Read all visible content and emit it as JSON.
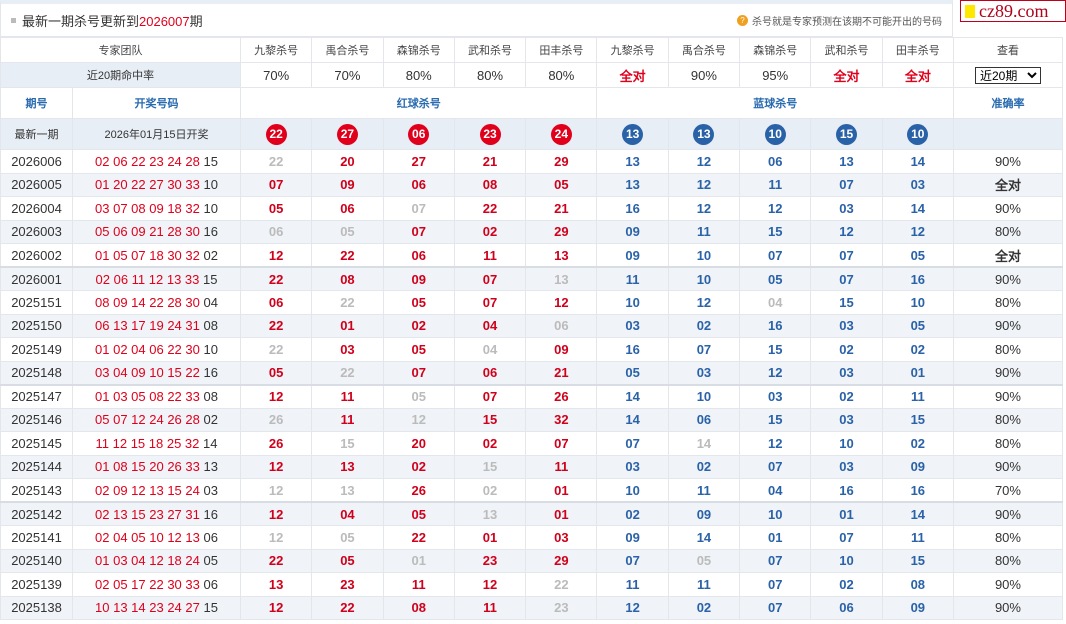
{
  "header": {
    "title_prefix": "最新一期杀号更新到",
    "latest_period": "2026007",
    "title_suffix": "期",
    "note": "杀号就是专家预测在该期不可能开出的号码",
    "note_icon": "question-icon"
  },
  "logo": "cz89.com",
  "experts": {
    "label": "专家团队",
    "names": [
      "九黎杀号",
      "禹合杀号",
      "森锦杀号",
      "武和杀号",
      "田丰杀号",
      "九黎杀号",
      "禹合杀号",
      "森锦杀号",
      "武和杀号",
      "田丰杀号"
    ],
    "view_label": "查看"
  },
  "rates": {
    "label": "近20期命中率",
    "values": [
      "70%",
      "70%",
      "80%",
      "80%",
      "80%",
      "全对",
      "90%",
      "95%",
      "全对",
      "全对"
    ],
    "select_value": "近20期"
  },
  "columns": {
    "period": "期号",
    "draw": "开奖号码",
    "red": "红球杀号",
    "blue": "蓝球杀号",
    "accuracy": "准确率"
  },
  "latest": {
    "label": "最新一期",
    "date": "2026年01月15日开奖",
    "red": [
      "22",
      "27",
      "06",
      "23",
      "24"
    ],
    "blue": [
      "13",
      "13",
      "10",
      "15",
      "10"
    ]
  },
  "colors": {
    "red": "#e0001b",
    "blue": "#2a62a8",
    "miss": "#bbbbbb"
  },
  "rows": [
    {
      "period": "2026006",
      "red_draw": "02 06 22 23 24 28",
      "blue_draw": "15",
      "red": [
        "22",
        "20",
        "27",
        "21",
        "29"
      ],
      "blue": [
        "13",
        "12",
        "06",
        "13",
        "14"
      ],
      "miss": [
        0
      ],
      "acc": "90%"
    },
    {
      "period": "2026005",
      "red_draw": "01 20 22 27 30 33",
      "blue_draw": "10",
      "red": [
        "07",
        "09",
        "06",
        "08",
        "05"
      ],
      "blue": [
        "13",
        "12",
        "11",
        "07",
        "03"
      ],
      "miss": [],
      "acc": "全对"
    },
    {
      "period": "2026004",
      "red_draw": "03 07 08 09 18 32",
      "blue_draw": "10",
      "red": [
        "05",
        "06",
        "07",
        "22",
        "21"
      ],
      "blue": [
        "16",
        "12",
        "12",
        "03",
        "14"
      ],
      "miss": [
        2
      ],
      "acc": "90%"
    },
    {
      "period": "2026003",
      "red_draw": "05 06 09 21 28 30",
      "blue_draw": "16",
      "red": [
        "06",
        "05",
        "07",
        "02",
        "29"
      ],
      "blue": [
        "09",
        "11",
        "15",
        "12",
        "12"
      ],
      "miss": [
        0,
        1
      ],
      "acc": "80%"
    },
    {
      "period": "2026002",
      "red_draw": "01 05 07 18 30 32",
      "blue_draw": "02",
      "red": [
        "12",
        "22",
        "06",
        "11",
        "13"
      ],
      "blue": [
        "09",
        "10",
        "07",
        "07",
        "05"
      ],
      "miss": [],
      "acc": "全对"
    },
    {
      "period": "2026001",
      "red_draw": "02 06 11 12 13 33",
      "blue_draw": "15",
      "red": [
        "22",
        "08",
        "09",
        "07",
        "13"
      ],
      "blue": [
        "11",
        "10",
        "05",
        "07",
        "16"
      ],
      "miss": [
        4
      ],
      "acc": "90%"
    },
    {
      "period": "2025151",
      "red_draw": "08 09 14 22 28 30",
      "blue_draw": "04",
      "red": [
        "06",
        "22",
        "05",
        "07",
        "12"
      ],
      "blue": [
        "10",
        "12",
        "04",
        "15",
        "10"
      ],
      "miss": [
        1,
        7
      ],
      "acc": "80%"
    },
    {
      "period": "2025150",
      "red_draw": "06 13 17 19 24 31",
      "blue_draw": "08",
      "red": [
        "22",
        "01",
        "02",
        "04",
        "06"
      ],
      "blue": [
        "03",
        "02",
        "16",
        "03",
        "05"
      ],
      "miss": [
        4
      ],
      "acc": "90%"
    },
    {
      "period": "2025149",
      "red_draw": "01 02 04 06 22 30",
      "blue_draw": "10",
      "red": [
        "22",
        "03",
        "05",
        "04",
        "09"
      ],
      "blue": [
        "16",
        "07",
        "15",
        "02",
        "02"
      ],
      "miss": [
        0,
        3
      ],
      "acc": "80%"
    },
    {
      "period": "2025148",
      "red_draw": "03 04 09 10 15 22",
      "blue_draw": "16",
      "red": [
        "05",
        "22",
        "07",
        "06",
        "21"
      ],
      "blue": [
        "05",
        "03",
        "12",
        "03",
        "01"
      ],
      "miss": [
        1
      ],
      "acc": "90%"
    },
    {
      "period": "2025147",
      "red_draw": "01 03 05 08 22 33",
      "blue_draw": "08",
      "red": [
        "12",
        "11",
        "05",
        "07",
        "26"
      ],
      "blue": [
        "14",
        "10",
        "03",
        "02",
        "11"
      ],
      "miss": [
        2
      ],
      "acc": "90%"
    },
    {
      "period": "2025146",
      "red_draw": "05 07 12 24 26 28",
      "blue_draw": "02",
      "red": [
        "26",
        "11",
        "12",
        "15",
        "32"
      ],
      "blue": [
        "14",
        "06",
        "15",
        "03",
        "15"
      ],
      "miss": [
        0,
        2
      ],
      "acc": "80%"
    },
    {
      "period": "2025145",
      "red_draw": "11 12 15 18 25 32",
      "blue_draw": "14",
      "red": [
        "26",
        "15",
        "20",
        "02",
        "07"
      ],
      "blue": [
        "07",
        "14",
        "12",
        "10",
        "02"
      ],
      "miss": [
        1,
        6
      ],
      "acc": "80%"
    },
    {
      "period": "2025144",
      "red_draw": "01 08 15 20 26 33",
      "blue_draw": "13",
      "red": [
        "12",
        "13",
        "02",
        "15",
        "11"
      ],
      "blue": [
        "03",
        "02",
        "07",
        "03",
        "09"
      ],
      "miss": [
        3
      ],
      "acc": "90%"
    },
    {
      "period": "2025143",
      "red_draw": "02 09 12 13 15 24",
      "blue_draw": "03",
      "red": [
        "12",
        "13",
        "26",
        "02",
        "01"
      ],
      "blue": [
        "10",
        "11",
        "04",
        "16",
        "16"
      ],
      "miss": [
        0,
        1,
        3
      ],
      "acc": "70%"
    },
    {
      "period": "2025142",
      "red_draw": "02 13 15 23 27 31",
      "blue_draw": "16",
      "red": [
        "12",
        "04",
        "05",
        "13",
        "01"
      ],
      "blue": [
        "02",
        "09",
        "10",
        "01",
        "14"
      ],
      "miss": [
        3
      ],
      "acc": "90%"
    },
    {
      "period": "2025141",
      "red_draw": "02 04 05 10 12 13",
      "blue_draw": "06",
      "red": [
        "12",
        "05",
        "22",
        "01",
        "03"
      ],
      "blue": [
        "09",
        "14",
        "01",
        "07",
        "11"
      ],
      "miss": [
        0,
        1
      ],
      "acc": "80%"
    },
    {
      "period": "2025140",
      "red_draw": "01 03 04 12 18 24",
      "blue_draw": "05",
      "red": [
        "22",
        "05",
        "01",
        "23",
        "29"
      ],
      "blue": [
        "07",
        "05",
        "07",
        "10",
        "15"
      ],
      "miss": [
        2,
        6
      ],
      "acc": "80%"
    },
    {
      "period": "2025139",
      "red_draw": "02 05 17 22 30 33",
      "blue_draw": "06",
      "red": [
        "13",
        "23",
        "11",
        "12",
        "22"
      ],
      "blue": [
        "11",
        "11",
        "07",
        "02",
        "08"
      ],
      "miss": [
        4
      ],
      "acc": "90%"
    },
    {
      "period": "2025138",
      "red_draw": "10 13 14 23 24 27",
      "blue_draw": "15",
      "red": [
        "12",
        "22",
        "08",
        "11",
        "23"
      ],
      "blue": [
        "12",
        "02",
        "07",
        "06",
        "09"
      ],
      "miss": [
        4
      ],
      "acc": "90%"
    }
  ]
}
